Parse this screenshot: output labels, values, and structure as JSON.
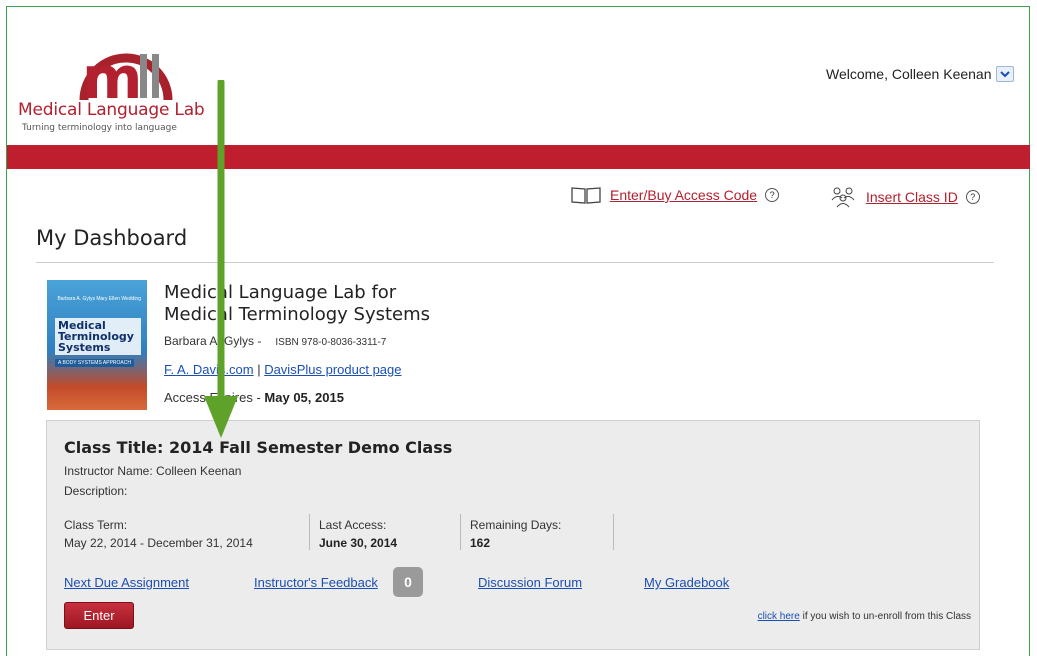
{
  "header": {
    "brand_name": "Medical Language Lab",
    "tagline": "Turning terminology into language",
    "welcome": "Welcome, Colleen Keenan",
    "brand_color": "#be1e2d"
  },
  "actions": {
    "access_code": "Enter/Buy Access Code",
    "insert_class": "Insert Class ID",
    "help_glyph": "?"
  },
  "page": {
    "title": "My Dashboard"
  },
  "product": {
    "cover": {
      "title": "Medical Terminology Systems",
      "subtitle": "A BODY SYSTEMS APPROACH",
      "authors": "Barbara A. Gylys Mary Ellen Wedding"
    },
    "title_line1": "Medical Language Lab for",
    "title_line2": "Medical Terminology Systems",
    "author": "Barbara A. Gylys -",
    "isbn": "ISBN 978-0-8036-3311-7",
    "link1": "F. A. Davis.com",
    "link_sep": " | ",
    "link2": "DavisPlus product page",
    "expires_label": "Access Expires - ",
    "expires_value": "May 05, 2015"
  },
  "class": {
    "title": "Class Title: 2014 Fall Semester Demo Class",
    "instructor": "Instructor Name: Colleen Keenan",
    "description": "Description:",
    "term_label": "Class Term:",
    "term_value": "May 22, 2014 - December 31, 2014",
    "last_access_label": "Last Access:",
    "last_access_value": "June 30, 2014",
    "remaining_label": "Remaining Days:",
    "remaining_value": "162",
    "links": {
      "next_due": "Next Due Assignment",
      "feedback": "Instructor's Feedback",
      "feedback_count": "0",
      "forum": "Discussion Forum",
      "gradebook": "My Gradebook"
    },
    "enter_label": "Enter",
    "unenroll_link": "click here",
    "unenroll_text": " if you wish to un-enroll from this Class"
  }
}
